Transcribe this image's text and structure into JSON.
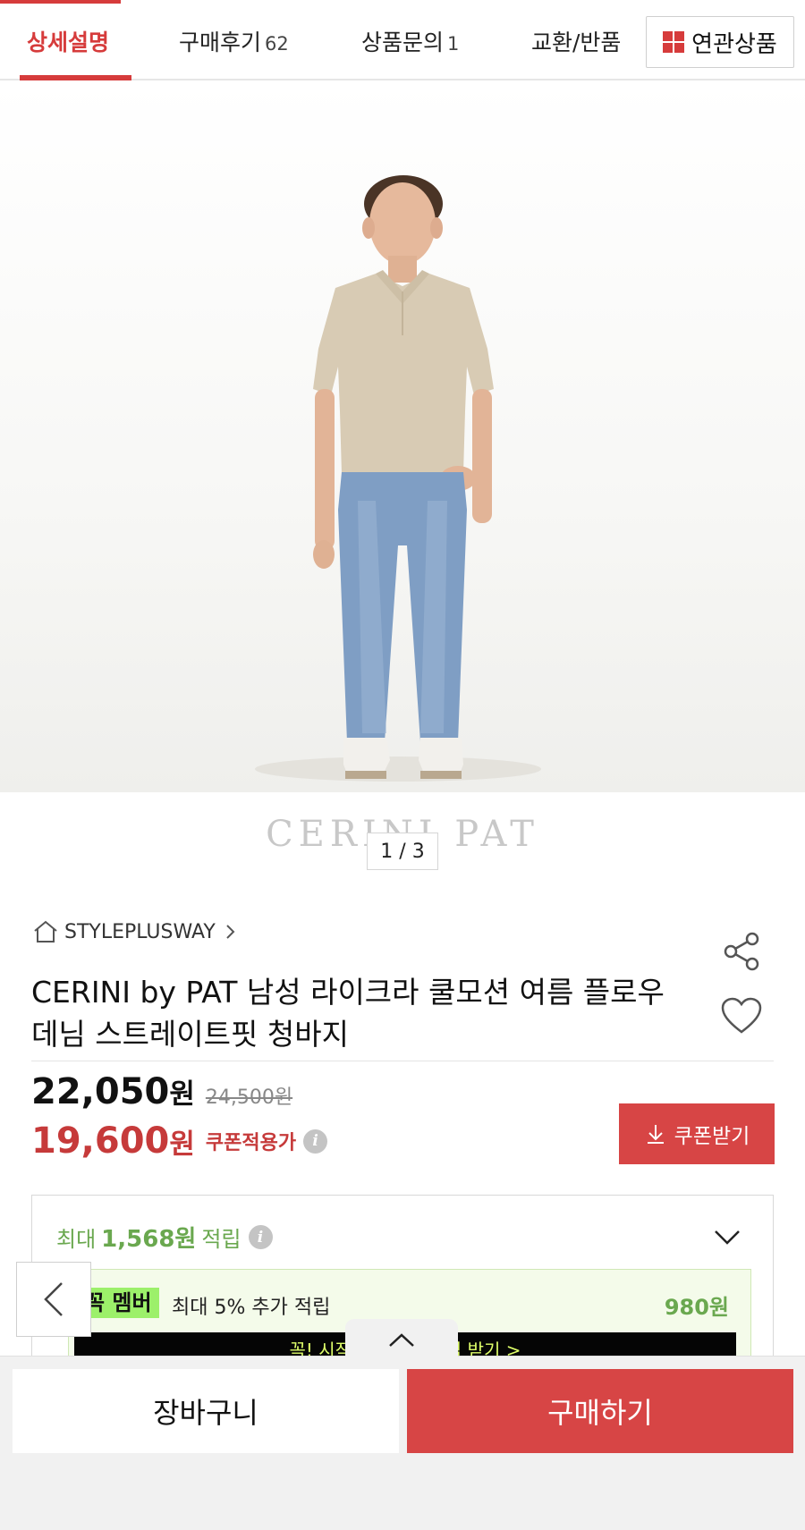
{
  "tabs": {
    "items": [
      {
        "label": "상세설명",
        "count": ""
      },
      {
        "label": "구매후기",
        "count": "62"
      },
      {
        "label": "상품문의",
        "count": "1"
      },
      {
        "label": "교환/반품",
        "count": ""
      }
    ],
    "related_label": "연관상품"
  },
  "gallery": {
    "brand_logo": "CERINI PAT",
    "pager": "1 / 3"
  },
  "product": {
    "seller": "STYLEPLUSWAY",
    "title": "CERINI by PAT 남성 라이크라 쿨모션 여름 플로우 데님 스트레이트핏 청바지",
    "price": "22,050",
    "price_unit": "원",
    "original_price": "24,500원",
    "coupon_price": "19,600",
    "coupon_price_unit": "원",
    "coupon_label": "쿠폰적용가",
    "coupon_button": "쿠폰받기"
  },
  "points": {
    "prefix": "최대",
    "amount": "1,568원",
    "suffix": "적립",
    "member_tag": "꼭 멤버",
    "member_text": "최대 5% 추가 적립",
    "member_amount": "980원",
    "member_strip": "꼭! 시작하고 추가 적립 받기 >"
  },
  "bottom": {
    "cart": "장바구니",
    "buy": "구매하기"
  },
  "colors": {
    "accent": "#d63b3b",
    "buy": "#d74545",
    "points": "#6aa84f",
    "member_tag": "#9cf06a"
  },
  "icons": [
    "grid-icon",
    "home-icon",
    "chevron-right-icon",
    "share-icon",
    "heart-icon",
    "info-icon",
    "download-icon",
    "chevron-down-icon",
    "chevron-left-icon",
    "chevron-up-icon"
  ]
}
